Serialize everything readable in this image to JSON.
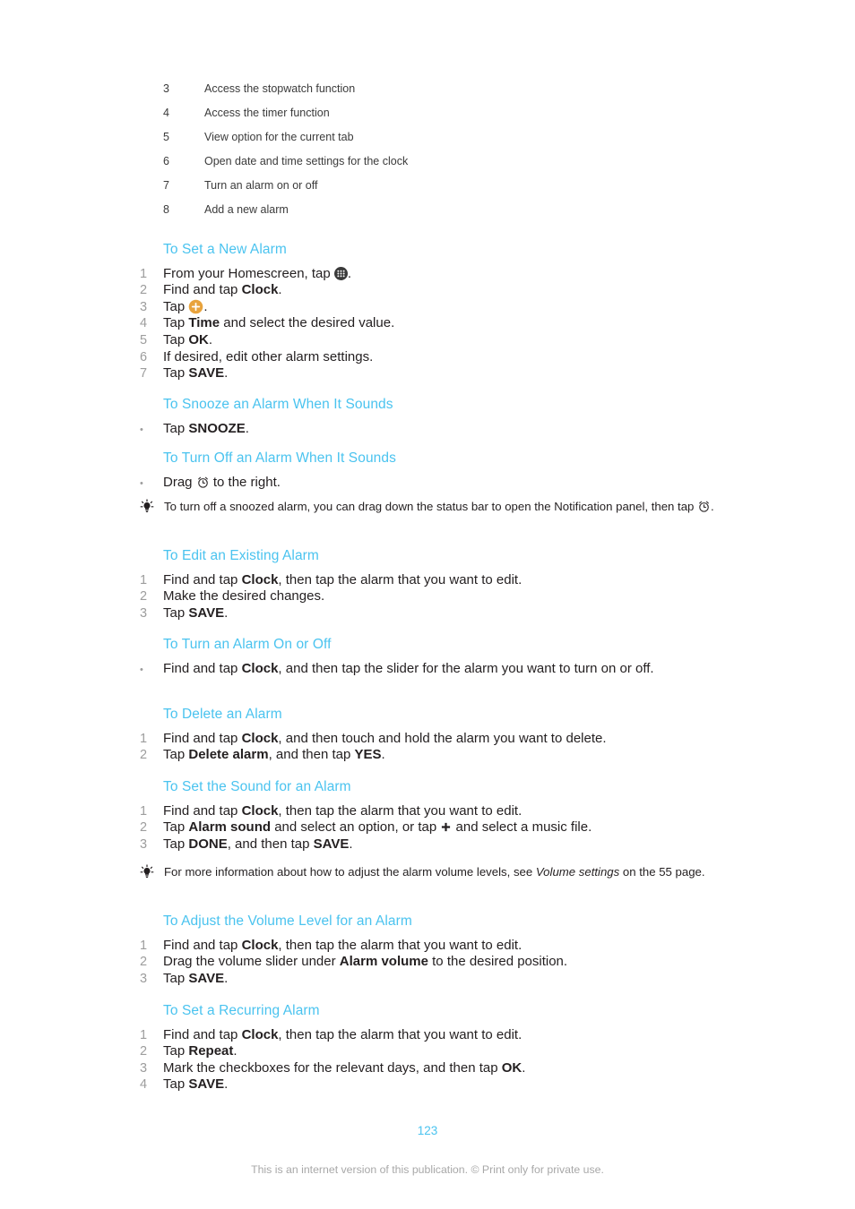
{
  "legend": {
    "rows": [
      {
        "num": "3",
        "text": "Access the stopwatch function"
      },
      {
        "num": "4",
        "text": "Access the timer function"
      },
      {
        "num": "5",
        "text": "View option for the current tab"
      },
      {
        "num": "6",
        "text": "Open date and time settings for the clock"
      },
      {
        "num": "7",
        "text": "Turn an alarm on or off"
      },
      {
        "num": "8",
        "text": "Add a new alarm"
      }
    ]
  },
  "sections": {
    "set_new_alarm": {
      "title": "To Set a New Alarm",
      "steps": {
        "n1": "1",
        "n2": "2",
        "n3": "3",
        "n4": "4",
        "n5": "5",
        "n6": "6",
        "n7": "7",
        "s1a": "From your Homescreen, tap ",
        "s1b": ".",
        "s2a": "Find and tap ",
        "s2b": "Clock",
        "s2c": ".",
        "s3a": "Tap ",
        "s3b": ".",
        "s4a": "Tap ",
        "s4b": "Time",
        "s4c": " and select the desired value.",
        "s5a": "Tap ",
        "s5b": "OK",
        "s5c": ".",
        "s6": "If desired, edit other alarm settings.",
        "s7a": "Tap ",
        "s7b": "SAVE",
        "s7c": "."
      }
    },
    "snooze_alarm": {
      "title": "To Snooze an Alarm When It Sounds",
      "bullet": "•",
      "s1a": "Tap ",
      "s1b": "SNOOZE",
      "s1c": "."
    },
    "turn_off_alarm": {
      "title": "To Turn Off an Alarm When It Sounds",
      "bullet": "•",
      "s1a": "Drag ",
      "s1b": " to the right."
    },
    "tip_snoozed": {
      "text_a": "To turn off a snoozed alarm, you can drag down the status bar to open the Notification panel, then tap ",
      "text_b": "."
    },
    "edit_existing_alarm": {
      "title": "To Edit an Existing Alarm",
      "n1": "1",
      "n2": "2",
      "n3": "3",
      "s1a": "Find and tap ",
      "s1b": "Clock",
      "s1c": ", then tap the alarm that you want to edit.",
      "s2": "Make the desired changes.",
      "s3a": "Tap ",
      "s3b": "SAVE",
      "s3c": "."
    },
    "turn_alarm_on_off": {
      "title": "To Turn an Alarm On or Off",
      "bullet": "•",
      "s1a": "Find and tap ",
      "s1b": "Clock",
      "s1c": ", and then tap the slider for the alarm you want to turn on or off."
    },
    "delete_alarm": {
      "title": "To Delete an Alarm",
      "n1": "1",
      "n2": "2",
      "s1a": "Find and tap ",
      "s1b": "Clock",
      "s1c": ", and then touch and hold the alarm you want to delete.",
      "s2a": "Tap ",
      "s2b": "Delete alarm",
      "s2c": ", and then tap ",
      "s2d": "YES",
      "s2e": "."
    },
    "set_sound": {
      "title": "To Set the Sound for an Alarm",
      "n1": "1",
      "n2": "2",
      "n3": "3",
      "s1a": "Find and tap ",
      "s1b": "Clock",
      "s1c": ", then tap the alarm that you want to edit.",
      "s2a": "Tap ",
      "s2b": "Alarm sound",
      "s2c": " and select an option, or tap ",
      "s2d": " and select a music file.",
      "s3a": "Tap ",
      "s3b": "DONE",
      "s3c": ", and then tap ",
      "s3d": "SAVE",
      "s3e": "."
    },
    "tip_volume": {
      "text_a": "For more information about how to adjust the alarm volume levels, see ",
      "text_italic": "Volume settings",
      "text_b": " on the 55 page."
    },
    "adjust_volume": {
      "title": "To Adjust the Volume Level for an Alarm",
      "n1": "1",
      "n2": "2",
      "n3": "3",
      "s1a": "Find and tap ",
      "s1b": "Clock",
      "s1c": ", then tap the alarm that you want to edit.",
      "s2a": "Drag the volume slider under ",
      "s2b": "Alarm volume",
      "s2c": " to the desired position.",
      "s3a": "Tap ",
      "s3b": "SAVE",
      "s3c": "."
    },
    "recurring_alarm": {
      "title": "To Set a Recurring Alarm",
      "n1": "1",
      "n2": "2",
      "n3": "3",
      "n4": "4",
      "s1a": "Find and tap ",
      "s1b": "Clock",
      "s1c": ", then tap the alarm that you want to edit.",
      "s2a": "Tap ",
      "s2b": "Repeat",
      "s2c": ".",
      "s3a": "Mark the checkboxes for the relevant days, and then tap ",
      "s3b": "OK",
      "s3c": ".",
      "s4a": "Tap ",
      "s4b": "SAVE",
      "s4c": "."
    }
  },
  "footer": {
    "page_number": "123",
    "note": "This is an internet version of this publication. © Print only for private use."
  },
  "colors": {
    "heading_blue": "#4ac3ef",
    "step_number_gray": "#9d9d9d",
    "body_text": "#231f20",
    "footer_gray": "#a8a8a8",
    "appdrawer_icon": "#3a3a3a",
    "plus_circle_icon": "#e8a33d"
  },
  "icons": {
    "app_drawer": "app-drawer-icon",
    "add_alarm": "plus-circle-icon",
    "alarm_clock": "alarm-clock-icon",
    "plus": "plus-icon",
    "tip": "lightbulb-tip-icon"
  }
}
